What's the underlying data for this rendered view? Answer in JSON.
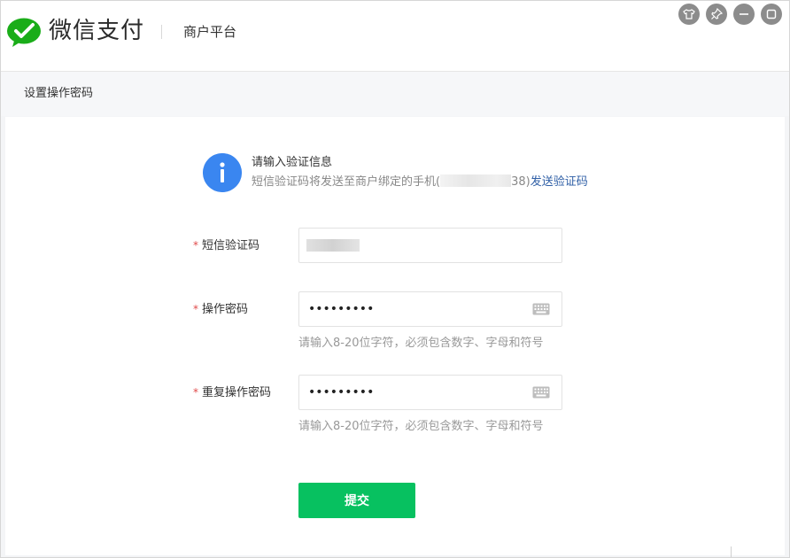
{
  "header": {
    "brand": "微信支付",
    "platform": "商户平台"
  },
  "page": {
    "title": "设置操作密码"
  },
  "notice": {
    "title": "请输入验证信息",
    "desc_prefix": "短信验证码将发送至商户绑定的手机(",
    "phone_suffix": "38)",
    "send_code_link": "发送验证码"
  },
  "form": {
    "sms_code": {
      "label": "短信验证码",
      "required_mark": "*"
    },
    "op_password": {
      "label": "操作密码",
      "required_mark": "*",
      "value": "•••••••••",
      "hint": "请输入8-20位字符，必须包含数字、字母和符号"
    },
    "confirm_password": {
      "label": "重复操作密码",
      "required_mark": "*",
      "value": "•••••••••",
      "hint": "请输入8-20位字符，必须包含数字、字母和符号"
    },
    "submit_label": "提交"
  },
  "colors": {
    "brand_green": "#07c160",
    "info_blue": "#3a86f0",
    "link_blue": "#2f5fa6",
    "required_red": "#e04a4a"
  },
  "icons": {
    "logo": "wechat-pay-logo-icon",
    "info": "info-icon",
    "keyboard": "keyboard-icon",
    "window_controls": [
      "skin-icon",
      "pin-icon",
      "minimize-icon",
      "maximize-icon"
    ]
  }
}
